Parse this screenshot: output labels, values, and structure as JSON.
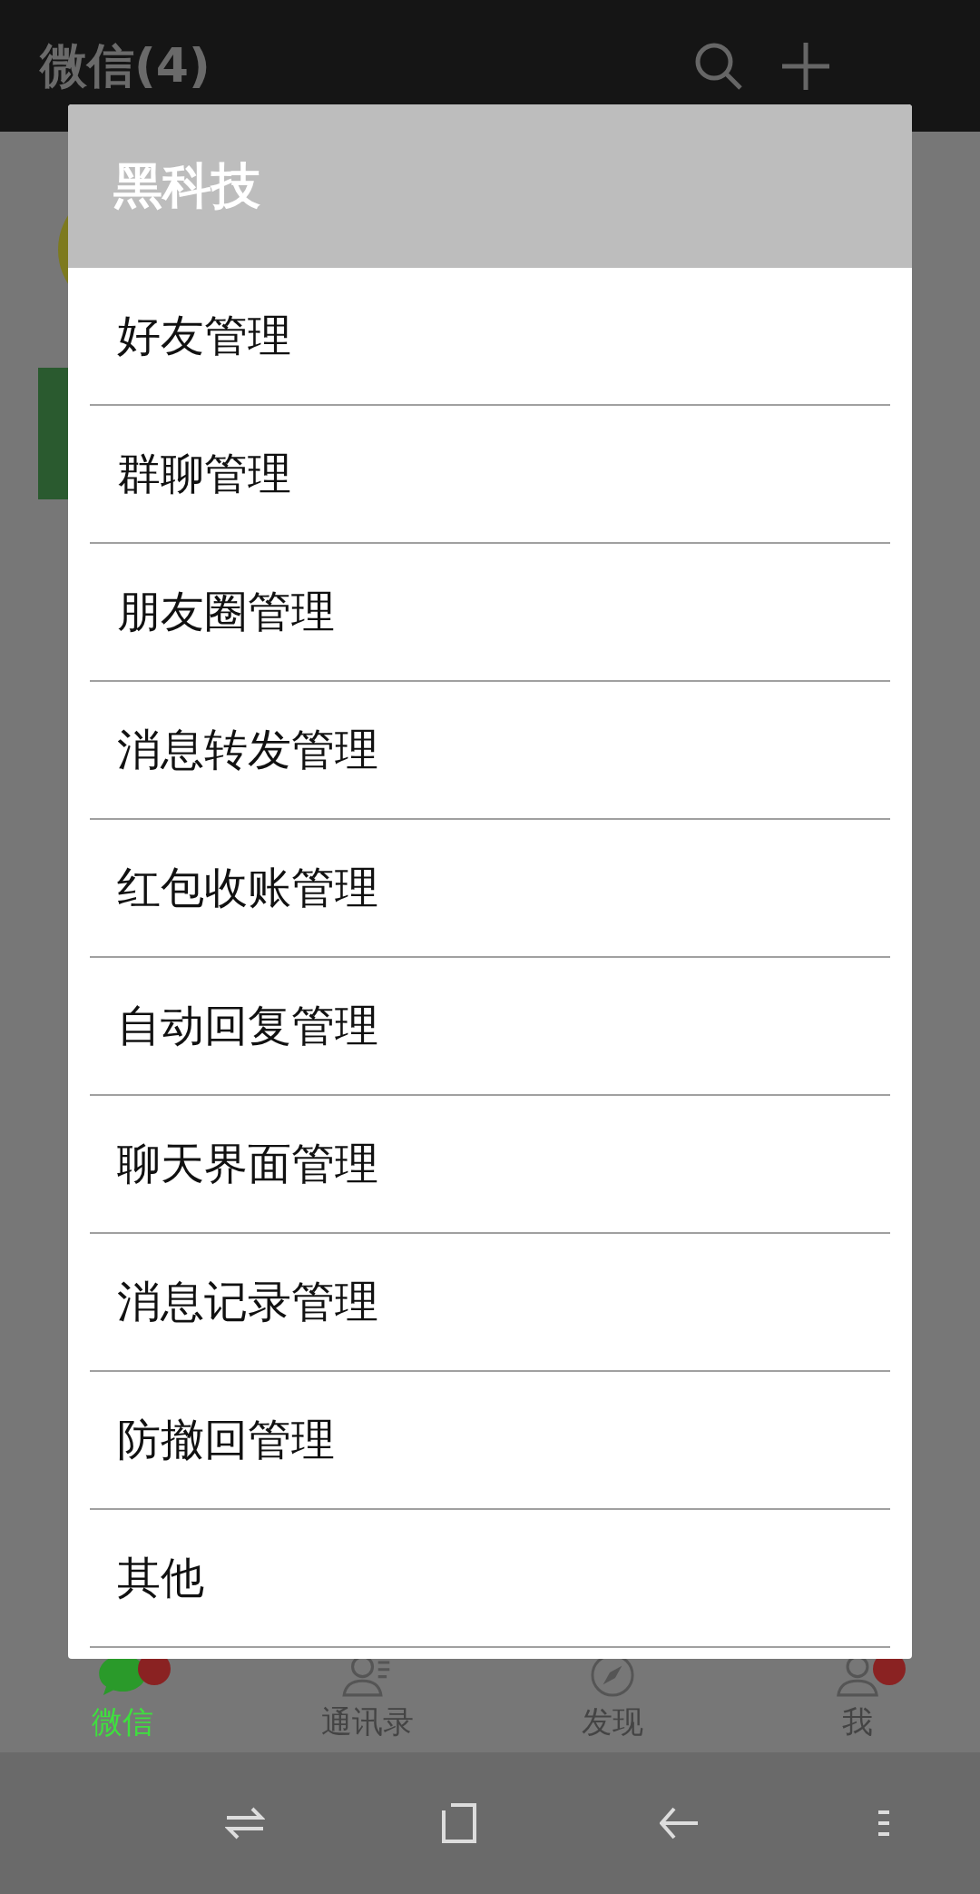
{
  "app_bar": {
    "title": "微信(4)"
  },
  "dialog": {
    "title": "黑科技",
    "items": [
      {
        "label": "好友管理"
      },
      {
        "label": "群聊管理"
      },
      {
        "label": "朋友圈管理"
      },
      {
        "label": "消息转发管理"
      },
      {
        "label": "红包收账管理"
      },
      {
        "label": "自动回复管理"
      },
      {
        "label": "聊天界面管理"
      },
      {
        "label": "消息记录管理"
      },
      {
        "label": "防撤回管理"
      },
      {
        "label": "其他"
      }
    ]
  },
  "tabs": [
    {
      "label": "微信",
      "selected": true,
      "badge": true
    },
    {
      "label": "通讯录",
      "selected": false,
      "badge": false
    },
    {
      "label": "发现",
      "selected": false,
      "badge": false
    },
    {
      "label": "我",
      "selected": false,
      "badge": true
    }
  ]
}
